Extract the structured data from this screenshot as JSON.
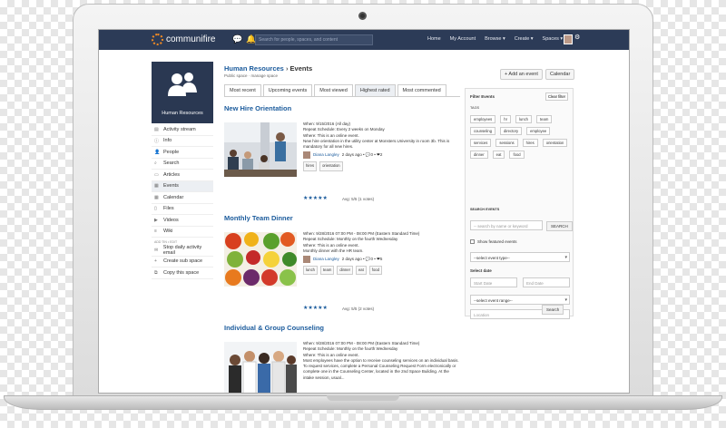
{
  "header": {
    "brand": "communifire",
    "search_placeholder": "Search for people, spaces, and content",
    "nav": [
      "Home",
      "My Account",
      "Browse ▾",
      "Create ▾",
      "Spaces ▾"
    ]
  },
  "sidebar": {
    "profile_label": "Human Resources",
    "items": [
      {
        "label": "Activity stream",
        "icon": "activity-icon"
      },
      {
        "label": "Info",
        "icon": "info-icon"
      },
      {
        "label": "People",
        "icon": "people-icon"
      },
      {
        "label": "Search",
        "icon": "search-icon"
      },
      {
        "label": "Articles",
        "icon": "articles-icon"
      },
      {
        "label": "Events",
        "icon": "calendar-icon"
      },
      {
        "label": "Calendar",
        "icon": "calendar-icon"
      },
      {
        "label": "Files",
        "icon": "file-icon"
      },
      {
        "label": "Videos",
        "icon": "video-icon"
      },
      {
        "label": "Wiki",
        "icon": "wiki-icon"
      }
    ],
    "section_label": "ADD TIN • EDIT",
    "actions": [
      "Stop daily activity email",
      "Create sub space",
      "Copy this space"
    ]
  },
  "main": {
    "breadcrumb_space": "Human Resources",
    "breadcrumb_sep": "›",
    "breadcrumb_page": "Events",
    "subcrumb": "Public space · manage space",
    "tabs": [
      "Most recent",
      "Upcoming events",
      "Most viewed",
      "Highest rated",
      "Most commented"
    ],
    "events": [
      {
        "title": "New Hire Orientation",
        "when": "When: 9/15/2016 (All day)",
        "repeat": "Repeat Schedule: Every 2 weeks on Monday",
        "where": "Where: This is an online event.",
        "desc": "New hire orientation in the utility center at Monsters.University in room 3b. This is mandatory for all new hires.",
        "author": "Diana Langley",
        "meta": "2 days ago • 💬0 • ❤2",
        "tags": [
          "hires",
          "orientation"
        ],
        "rating": "Avg: 5/5 (1 votes)"
      },
      {
        "title": "Monthly Team Dinner",
        "when": "When: 9/28/2016 07:00 PM - 08:00 PM (Eastern Standard Time)",
        "repeat": "Repeat Schedule: Monthly on the fourth Wednesday",
        "where": "Where: This is an online event.",
        "desc": "Monthly dinner with the HR team.",
        "author": "Diana Langley",
        "meta": "2 days ago • 💬0 • ❤5",
        "tags": [
          "lunch",
          "team",
          "dinner",
          "eat",
          "food"
        ],
        "rating": "Avg: 5/5 (2 votes)"
      },
      {
        "title": "Individual & Group Counseling",
        "when": "When: 9/28/2016 07:00 PM - 08:00 PM (Eastern Standard Time)",
        "repeat": "Repeat Schedule: Monthly on the fourth Wednesday",
        "where": "Where: This is an online event.",
        "desc": "Most employees have the option to receive counseling services on an individual basis. To request services, complete a Personal Counseling Request Form electronically or complete one in the Counseling Center, located in the 2nd Space Building. At the intake session, usual..."
      }
    ]
  },
  "actions": {
    "add_event": "+ Add an event",
    "calendar": "Calendar"
  },
  "filter": {
    "title": "Filter Events",
    "clear": "Clear filter",
    "tags_heading": "TAGS",
    "tags": [
      "employees",
      "hr",
      "lunch",
      "team",
      "counseling",
      "directory",
      "employee",
      "services",
      "sessions",
      "hires",
      "orientation",
      "dinner",
      "eat",
      "food"
    ],
    "search_heading": "SEARCH EVENTS",
    "search_placeholder": "-- search by name or keyword",
    "search_btn": "SEARCH",
    "featured_label": "Show featured events",
    "event_type": "--select event type--",
    "date_heading": "Select date",
    "start_date": "Start Date",
    "end_date": "End Date",
    "event_range": "--select event range--",
    "location": "Location",
    "submit": "Search"
  }
}
